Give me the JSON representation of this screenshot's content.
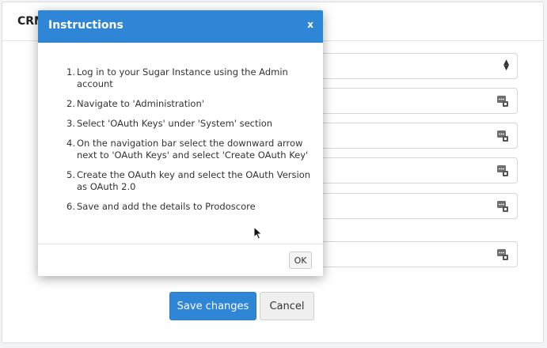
{
  "card": {
    "title": "CRM"
  },
  "form": {
    "fields": [
      {
        "type": "select",
        "value": ""
      },
      {
        "type": "password",
        "value": ""
      },
      {
        "type": "password",
        "value": ""
      },
      {
        "type": "password",
        "value": ""
      },
      {
        "type": "password",
        "value": ""
      },
      {
        "type": "password",
        "value": ""
      }
    ],
    "save_label": "Save changes",
    "cancel_label": "Cancel"
  },
  "modal": {
    "title": "Instructions",
    "close_label": "x",
    "steps": [
      {
        "num": "1.",
        "text": "Log in to your Sugar Instance using the Admin account"
      },
      {
        "num": "2.",
        "text": "Navigate to 'Administration'"
      },
      {
        "num": "3.",
        "text": "Select 'OAuth Keys' under 'System' section"
      },
      {
        "num": "4.",
        "text": "On the navigation bar select the downward arrow next to 'OAuth Keys' and select 'Create OAuth Key'"
      },
      {
        "num": "5.",
        "text": "Create the OAuth key and select the OAuth Version as OAuth 2.0"
      },
      {
        "num": "6.",
        "text": "Save and add the details to Prodoscore"
      }
    ],
    "ok_label": "OK"
  },
  "icons": {
    "field_icon": "key-fill-icon",
    "select_arrows": "select-arrows-icon",
    "cursor": "mouse-pointer-icon"
  },
  "colors": {
    "primary": "#2f86d6"
  }
}
